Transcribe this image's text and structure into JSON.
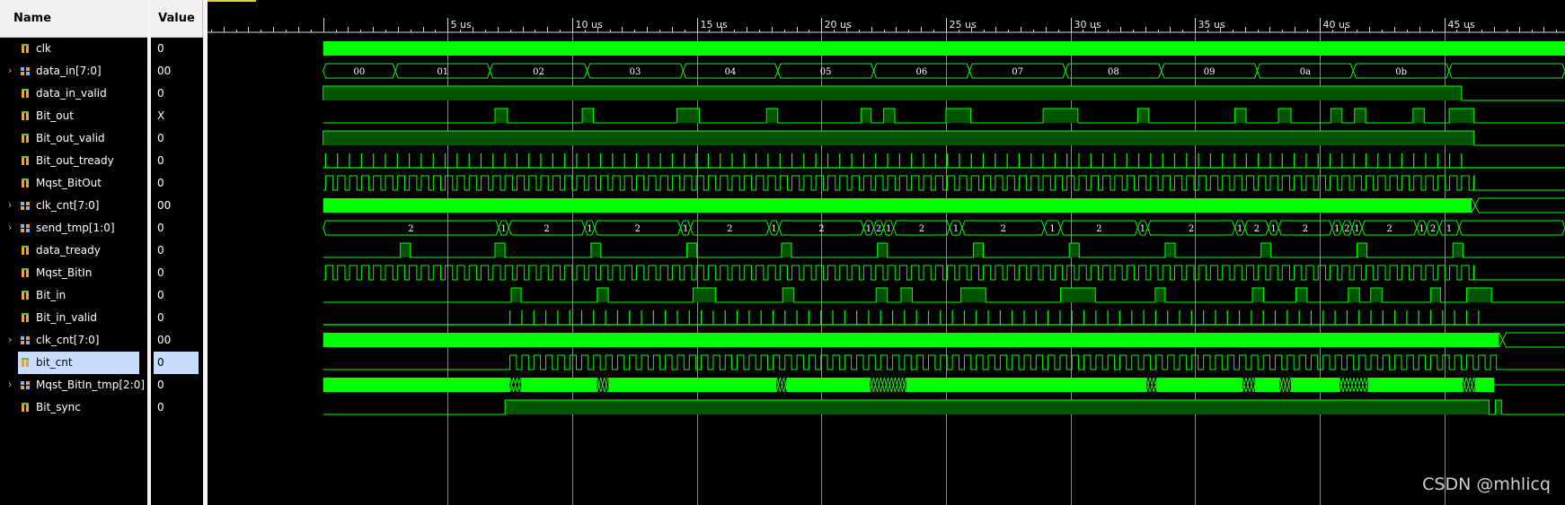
{
  "headers": {
    "name": "Name",
    "value": "Value"
  },
  "time_unit": "us",
  "timeline": {
    "start_us": -4.64,
    "end_us": 49.85,
    "major_ticks": [
      {
        "t": 5,
        "label": "5 us"
      },
      {
        "t": 10,
        "label": "10 us"
      },
      {
        "t": 15,
        "label": "15 us"
      },
      {
        "t": 20,
        "label": "20 us"
      },
      {
        "t": 25,
        "label": "25 us"
      },
      {
        "t": 30,
        "label": "30 us"
      },
      {
        "t": 35,
        "label": "35 us"
      },
      {
        "t": 40,
        "label": "40 us"
      },
      {
        "t": 45,
        "label": "45 us"
      }
    ]
  },
  "colors": {
    "wave": "#00ff00",
    "wave_fill": "#005500",
    "background": "#000000",
    "cursor": "#d8d840",
    "gridline": "#cccccc",
    "header_bg": "#f0f0f0",
    "selected_bg": "#c8dcff"
  },
  "signals": [
    {
      "name": "clk",
      "value": "0",
      "icon": "bit-signal-icon",
      "expandable": false,
      "wave": {
        "type": "clock",
        "to": 49.85
      }
    },
    {
      "name": "data_in[7:0]",
      "value": "00",
      "icon": "bus-signal-icon",
      "expandable": true,
      "wave": {
        "type": "bus",
        "segments": [
          {
            "s": 0,
            "e": 2.9,
            "label": "00"
          },
          {
            "s": 2.9,
            "e": 6.7,
            "label": "01"
          },
          {
            "s": 6.7,
            "e": 10.6,
            "label": "02"
          },
          {
            "s": 10.6,
            "e": 14.45,
            "label": "03"
          },
          {
            "s": 14.45,
            "e": 18.25,
            "label": "04"
          },
          {
            "s": 18.25,
            "e": 22.1,
            "label": "05"
          },
          {
            "s": 22.1,
            "e": 25.95,
            "label": "06"
          },
          {
            "s": 25.95,
            "e": 29.8,
            "label": "07"
          },
          {
            "s": 29.8,
            "e": 33.65,
            "label": "08"
          },
          {
            "s": 33.65,
            "e": 37.5,
            "label": "09"
          },
          {
            "s": 37.5,
            "e": 41.35,
            "label": "0a"
          },
          {
            "s": 41.35,
            "e": 45.2,
            "label": "0b"
          },
          {
            "s": 45.2,
            "e": 49.85,
            "label": ""
          }
        ]
      }
    },
    {
      "name": "data_in_valid",
      "value": "0",
      "icon": "bit-signal-icon",
      "expandable": false,
      "wave": {
        "type": "pulses",
        "pulses": [
          [
            0,
            45.7
          ]
        ]
      }
    },
    {
      "name": "Bit_out",
      "value": "X",
      "icon": "bit-signal-icon",
      "expandable": false,
      "wave": {
        "type": "pulses",
        "pulses": [
          [
            6.9,
            7.4
          ],
          [
            10.4,
            10.85
          ],
          [
            14.2,
            15.1
          ],
          [
            17.8,
            18.25
          ],
          [
            21.6,
            22.0
          ],
          [
            22.5,
            22.95
          ],
          [
            25.0,
            26.0
          ],
          [
            28.9,
            30.3
          ],
          [
            32.7,
            33.15
          ],
          [
            36.6,
            37.05
          ],
          [
            38.35,
            38.85
          ],
          [
            40.45,
            40.9
          ],
          [
            41.4,
            41.85
          ],
          [
            43.75,
            44.2
          ],
          [
            45.2,
            46.2
          ]
        ]
      }
    },
    {
      "name": "Bit_out_valid",
      "value": "0",
      "icon": "bit-signal-icon",
      "expandable": false,
      "wave": {
        "type": "pulses",
        "pulses": [
          [
            0,
            46.2
          ]
        ]
      }
    },
    {
      "name": "Bit_out_tready",
      "value": "0",
      "icon": "bit-signal-icon",
      "expandable": false,
      "wave": {
        "type": "spikes",
        "from": 0.1,
        "to": 46.1,
        "period": 0.48
      }
    },
    {
      "name": "Mqst_BitOut",
      "value": "0",
      "icon": "bit-signal-icon",
      "expandable": false,
      "wave": {
        "type": "pattern",
        "from": 0.1,
        "to": 46.2,
        "period": 0.48,
        "duty": 0.62
      }
    },
    {
      "name": "clk_cnt[7:0]",
      "value": "00",
      "icon": "bus-signal-icon",
      "expandable": true,
      "wave": {
        "type": "dense",
        "from": 0,
        "to": 46.1,
        "tail_label": ""
      }
    },
    {
      "name": "send_tmp[1:0]",
      "value": "0",
      "icon": "bus-signal-icon",
      "expandable": true,
      "wave": {
        "type": "bus",
        "segments": [
          {
            "s": 0,
            "e": 7.05,
            "label": "2"
          },
          {
            "s": 7.05,
            "e": 7.45,
            "label": "1"
          },
          {
            "s": 7.45,
            "e": 10.5,
            "label": "2"
          },
          {
            "s": 10.5,
            "e": 10.9,
            "label": "1"
          },
          {
            "s": 10.9,
            "e": 14.35,
            "label": "2"
          },
          {
            "s": 14.35,
            "e": 14.75,
            "label": "1"
          },
          {
            "s": 14.75,
            "e": 17.9,
            "label": "2"
          },
          {
            "s": 17.9,
            "e": 18.3,
            "label": "1"
          },
          {
            "s": 18.3,
            "e": 21.7,
            "label": "2"
          },
          {
            "s": 21.7,
            "e": 22.1,
            "label": "1"
          },
          {
            "s": 22.1,
            "e": 22.5,
            "label": "2"
          },
          {
            "s": 22.5,
            "e": 22.9,
            "label": "1"
          },
          {
            "s": 22.9,
            "e": 25.15,
            "label": "2"
          },
          {
            "s": 25.15,
            "e": 25.65,
            "label": "1"
          },
          {
            "s": 25.65,
            "e": 28.95,
            "label": "2"
          },
          {
            "s": 28.95,
            "e": 29.6,
            "label": "1"
          },
          {
            "s": 29.6,
            "e": 32.7,
            "label": "2"
          },
          {
            "s": 32.7,
            "e": 33.1,
            "label": "1"
          },
          {
            "s": 33.1,
            "e": 36.6,
            "label": "2"
          },
          {
            "s": 36.6,
            "e": 37.0,
            "label": "1"
          },
          {
            "s": 37.0,
            "e": 37.95,
            "label": "2"
          },
          {
            "s": 37.95,
            "e": 38.35,
            "label": "1"
          },
          {
            "s": 38.35,
            "e": 40.5,
            "label": "2"
          },
          {
            "s": 40.5,
            "e": 40.9,
            "label": "1"
          },
          {
            "s": 40.9,
            "e": 41.3,
            "label": "2"
          },
          {
            "s": 41.3,
            "e": 41.7,
            "label": "1"
          },
          {
            "s": 41.7,
            "e": 43.9,
            "label": "2"
          },
          {
            "s": 43.9,
            "e": 44.3,
            "label": "1"
          },
          {
            "s": 44.3,
            "e": 44.8,
            "label": "2"
          },
          {
            "s": 44.8,
            "e": 45.6,
            "label": "1"
          },
          {
            "s": 45.6,
            "e": 49.85,
            "label": ""
          }
        ]
      }
    },
    {
      "name": "data_tready",
      "value": "0",
      "icon": "bit-signal-icon",
      "expandable": false,
      "wave": {
        "type": "pulses",
        "pulses": [
          [
            3.1,
            3.5
          ],
          [
            6.9,
            7.3
          ],
          [
            10.75,
            11.15
          ],
          [
            14.6,
            15.0
          ],
          [
            18.4,
            18.8
          ],
          [
            22.25,
            22.65
          ],
          [
            26.1,
            26.5
          ],
          [
            29.95,
            30.35
          ],
          [
            33.8,
            34.2
          ],
          [
            37.65,
            38.05
          ],
          [
            41.5,
            41.9
          ],
          [
            45.35,
            45.75
          ]
        ]
      }
    },
    {
      "name": "Mqst_BitIn",
      "value": "0",
      "icon": "bit-signal-icon",
      "expandable": false,
      "wave": {
        "type": "pattern",
        "from": 0.1,
        "to": 46.2,
        "period": 0.48,
        "duty": 0.62
      }
    },
    {
      "name": "Bit_in",
      "value": "0",
      "icon": "bit-signal-icon",
      "expandable": false,
      "wave": {
        "type": "pulses",
        "pulses": [
          [
            7.55,
            7.95
          ],
          [
            11.0,
            11.45
          ],
          [
            14.85,
            15.75
          ],
          [
            18.45,
            18.9
          ],
          [
            22.2,
            22.65
          ],
          [
            23.2,
            23.65
          ],
          [
            25.6,
            26.6
          ],
          [
            29.6,
            31.0
          ],
          [
            33.4,
            33.8
          ],
          [
            37.3,
            37.75
          ],
          [
            39.05,
            39.5
          ],
          [
            41.15,
            41.6
          ],
          [
            42.05,
            42.5
          ],
          [
            44.45,
            44.85
          ],
          [
            45.9,
            46.9
          ]
        ]
      }
    },
    {
      "name": "Bit_in_valid",
      "value": "0",
      "icon": "bit-signal-icon",
      "expandable": false,
      "wave": {
        "type": "spikes",
        "from": 7.5,
        "to": 46.4,
        "period": 0.48
      }
    },
    {
      "name": "clk_cnt[7:0]",
      "value": "00",
      "icon": "bus-signal-icon",
      "expandable": true,
      "wave": {
        "type": "dense",
        "from": 0,
        "to": 47.2,
        "tail_label": ""
      }
    },
    {
      "name": "bit_cnt",
      "value": "0",
      "icon": "bit-signal-icon",
      "expandable": false,
      "selected": true,
      "wave": {
        "type": "pattern",
        "from": 7.5,
        "to": 47.1,
        "period": 0.48,
        "duty": 0.55
      }
    },
    {
      "name": "Mqst_BitIn_tmp[2:0]",
      "value": "0",
      "icon": "bus-signal-icon",
      "expandable": true,
      "wave": {
        "type": "busfill",
        "blocks": [
          [
            0,
            7.5
          ],
          [
            7.95,
            11.0
          ],
          [
            11.45,
            18.2
          ],
          [
            18.6,
            21.95
          ],
          [
            23.4,
            33.05
          ],
          [
            33.45,
            36.9
          ],
          [
            37.4,
            38.4
          ],
          [
            38.85,
            40.8
          ],
          [
            41.95,
            45.75
          ],
          [
            46.25,
            47.0
          ]
        ]
      }
    },
    {
      "name": "Bit_sync",
      "value": "0",
      "icon": "bit-signal-icon",
      "expandable": false,
      "wave": {
        "type": "pulses",
        "pulses": [
          [
            7.3,
            46.8
          ],
          [
            47.05,
            47.3
          ]
        ]
      }
    }
  ],
  "watermark": "CSDN @mhlicq"
}
